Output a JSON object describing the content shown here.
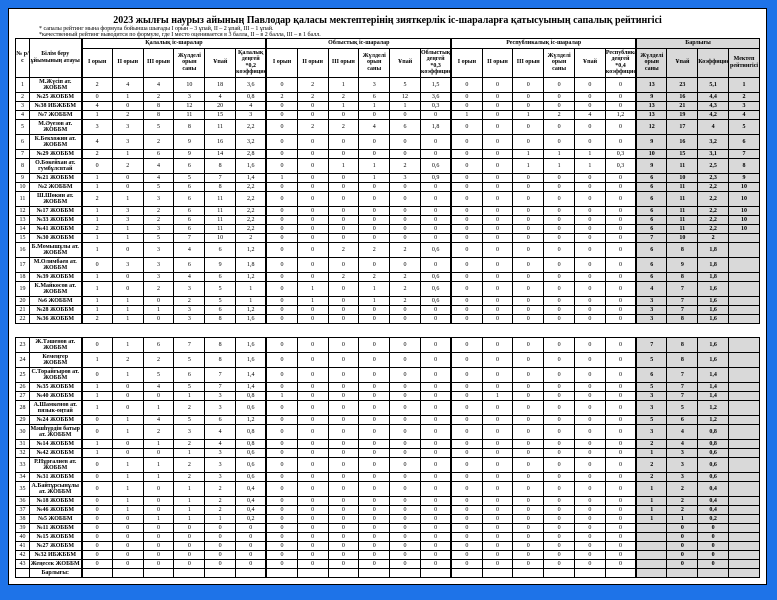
{
  "title": "2023 жылғы наурыз айының Павлодар қаласы мектептерінің зияткерлік іс-шараларға қатысуының сапалық рейтингісі",
  "note1": "* сапалы рейтинг мына формула бойынша шығады І орын – 3 ұпай, ІІ – 2 ұпай, ІІІ – 1 ұпай.",
  "note2": "*качественный рейтинг выводится по формуле, где І место оценивается в 3 балла, ІІ – в 2 балла, ІІІ – в 1 балл.",
  "grp": [
    "Қалалық іс-шаралар",
    "Облыстық іс-шаралар",
    "Республикалық іс-шаралар",
    "Барлығы"
  ],
  "col0": "№ р/с",
  "col1": "Білім беру ұйымының атауы",
  "cols_city": [
    "І орын",
    "ІІ орын",
    "ІІІ орын",
    "Жүлделі орын саны",
    "Ұпай",
    "Қалалық деңгей *0,2 коэффициенті"
  ],
  "cols_obl": [
    "І орын",
    "ІІ орын",
    "ІІІ орын",
    "Жүлделі орын саны",
    "Ұпай",
    "Облыстық деңгей *0,3 коэффициенті"
  ],
  "cols_rep": [
    "І орын",
    "ІІ орын",
    "ІІІ орын",
    "Жүлделі орын саны",
    "Ұпай",
    "Республикалық деңгей *0,4 коэффициенті"
  ],
  "cols_tot": [
    "Жүлделі орын саны",
    "Ұпай",
    "Коэффициенті",
    "Мектеп рейтингісі"
  ],
  "rows1": [
    {
      "n": 1,
      "name": "М.Жүсіп ат. ЖОББМ",
      "c": [
        2,
        4,
        4,
        10,
        18,
        "3,6"
      ],
      "o": [
        0,
        2,
        1,
        3,
        5,
        "1,5"
      ],
      "r": [
        0,
        0,
        0,
        0,
        0,
        0
      ],
      "t": [
        13,
        23,
        "5,1",
        1
      ]
    },
    {
      "n": 2,
      "name": "№25 ЖОББМ",
      "c": [
        0,
        1,
        2,
        3,
        4,
        "0,8"
      ],
      "o": [
        2,
        2,
        2,
        6,
        12,
        "3,6"
      ],
      "r": [
        0,
        0,
        0,
        0,
        0,
        0
      ],
      "t": [
        9,
        16,
        "4,4",
        2
      ]
    },
    {
      "n": 3,
      "name": "№38 ИБЖББМ",
      "c": [
        4,
        0,
        8,
        12,
        20,
        4
      ],
      "o": [
        0,
        0,
        1,
        1,
        1,
        "0,3"
      ],
      "r": [
        0,
        0,
        0,
        0,
        0,
        0
      ],
      "t": [
        13,
        21,
        "4,3",
        3
      ]
    },
    {
      "n": 4,
      "name": "№7 ЖОББМ",
      "c": [
        1,
        2,
        8,
        11,
        15,
        3
      ],
      "o": [
        0,
        0,
        0,
        0,
        0,
        0
      ],
      "r": [
        1,
        0,
        1,
        2,
        4,
        "1,2"
      ],
      "t": [
        13,
        19,
        "4,2",
        4
      ]
    },
    {
      "n": 5,
      "name": "М.Әуезов ат. ЖОББМ",
      "c": [
        3,
        3,
        5,
        8,
        11,
        "2,2"
      ],
      "o": [
        0,
        2,
        2,
        4,
        6,
        "1,8"
      ],
      "r": [
        0,
        0,
        0,
        0,
        0,
        0
      ],
      "t": [
        12,
        17,
        4,
        5
      ]
    },
    {
      "n": 6,
      "name": "К.Бекхожин ат. ЖОББМ",
      "c": [
        4,
        3,
        2,
        9,
        16,
        "3,2"
      ],
      "o": [
        0,
        0,
        0,
        0,
        0,
        0
      ],
      "r": [
        0,
        0,
        0,
        0,
        0,
        0
      ],
      "t": [
        9,
        16,
        "3,2",
        6
      ]
    },
    {
      "n": 7,
      "name": "№29 ЖОББМ",
      "c": [
        2,
        1,
        6,
        9,
        14,
        "2,8"
      ],
      "o": [
        0,
        0,
        0,
        0,
        0,
        0
      ],
      "r": [
        0,
        0,
        1,
        1,
        1,
        "0,3"
      ],
      "t": [
        10,
        15,
        "3,1",
        7
      ]
    },
    {
      "n": 8,
      "name": "О.Бокейхан ат. гумбұлсвтай",
      "c": [
        0,
        2,
        4,
        6,
        8,
        "1,6"
      ],
      "o": [
        0,
        0,
        1,
        1,
        2,
        "0,6"
      ],
      "r": [
        0,
        0,
        1,
        1,
        1,
        "0,3"
      ],
      "t": [
        9,
        11,
        "2,5",
        8
      ]
    },
    {
      "n": 9,
      "name": "№21 ЖОББМ",
      "c": [
        1,
        0,
        4,
        5,
        7,
        "1,4"
      ],
      "o": [
        1,
        0,
        0,
        1,
        3,
        "0,9"
      ],
      "r": [
        0,
        0,
        0,
        0,
        0,
        0
      ],
      "t": [
        6,
        10,
        "2,3",
        9
      ]
    },
    {
      "n": 10,
      "name": "№2 ЖОББМ",
      "c": [
        1,
        0,
        5,
        6,
        8,
        "2,2"
      ],
      "o": [
        0,
        0,
        0,
        0,
        0,
        0
      ],
      "r": [
        0,
        0,
        0,
        0,
        0,
        0
      ],
      "t": [
        6,
        11,
        "2,2",
        10
      ]
    },
    {
      "n": 11,
      "name": "Ш.Шөкин ат. ЖОББМ",
      "c": [
        2,
        1,
        3,
        6,
        11,
        "2,2"
      ],
      "o": [
        0,
        0,
        0,
        0,
        0,
        0
      ],
      "r": [
        0,
        0,
        0,
        0,
        0,
        0
      ],
      "t": [
        6,
        11,
        "2,2",
        10
      ]
    },
    {
      "n": 12,
      "name": "№17 ЖОББМ",
      "c": [
        1,
        3,
        2,
        6,
        11,
        "2,2"
      ],
      "o": [
        0,
        0,
        0,
        0,
        0,
        0
      ],
      "r": [
        0,
        0,
        0,
        0,
        0,
        0
      ],
      "t": [
        6,
        11,
        "2,2",
        10
      ]
    },
    {
      "n": 13,
      "name": "№33 ЖОББМ",
      "c": [
        1,
        3,
        2,
        6,
        11,
        "2,2"
      ],
      "o": [
        0,
        0,
        0,
        0,
        0,
        0
      ],
      "r": [
        0,
        0,
        0,
        0,
        0,
        0
      ],
      "t": [
        6,
        11,
        "2,2",
        10
      ]
    },
    {
      "n": 14,
      "name": "№41 ЖОББМ",
      "c": [
        2,
        1,
        3,
        6,
        11,
        "2,2"
      ],
      "o": [
        0,
        0,
        0,
        0,
        0,
        0
      ],
      "r": [
        0,
        0,
        0,
        0,
        0,
        0
      ],
      "t": [
        6,
        11,
        "2,2",
        10
      ]
    },
    {
      "n": 15,
      "name": "№30 ЖОББМ",
      "c": [
        1,
        1,
        5,
        7,
        10,
        2
      ],
      "o": [
        0,
        0,
        0,
        0,
        0,
        0
      ],
      "r": [
        0,
        0,
        0,
        0,
        0,
        0
      ],
      "t": [
        7,
        10,
        2,
        ""
      ]
    },
    {
      "n": 16,
      "name": "Б.Момышұлы ат. ЖОББМ",
      "c": [
        1,
        0,
        3,
        4,
        6,
        "1,2"
      ],
      "o": [
        0,
        0,
        2,
        2,
        2,
        "0,6"
      ],
      "r": [
        0,
        0,
        0,
        0,
        0,
        0
      ],
      "t": [
        6,
        8,
        "1,8",
        ""
      ]
    },
    {
      "n": 17,
      "name": "М.Олимбаев ат. ЖОББМ",
      "c": [
        0,
        3,
        3,
        6,
        9,
        "1,8"
      ],
      "o": [
        0,
        0,
        0,
        0,
        0,
        0
      ],
      "r": [
        0,
        0,
        0,
        0,
        0,
        0
      ],
      "t": [
        6,
        9,
        "1,8",
        ""
      ]
    },
    {
      "n": 18,
      "name": "№39 ЖОББМ",
      "c": [
        1,
        0,
        3,
        4,
        6,
        "1,2"
      ],
      "o": [
        0,
        0,
        2,
        2,
        2,
        "0,6"
      ],
      "r": [
        0,
        0,
        0,
        0,
        0,
        0
      ],
      "t": [
        6,
        8,
        "1,8",
        ""
      ]
    },
    {
      "n": 19,
      "name": "К.Майкөсов ат. ЖОББМ",
      "c": [
        1,
        0,
        2,
        3,
        5,
        1
      ],
      "o": [
        0,
        1,
        0,
        1,
        2,
        "0,6"
      ],
      "r": [
        0,
        0,
        0,
        0,
        0,
        0
      ],
      "t": [
        4,
        7,
        "1,6",
        ""
      ]
    },
    {
      "n": 20,
      "name": "№6 ЖОББМ",
      "c": [
        1,
        1,
        0,
        2,
        5,
        1
      ],
      "o": [
        0,
        1,
        0,
        1,
        2,
        "0,6"
      ],
      "r": [
        0,
        0,
        0,
        0,
        0,
        0
      ],
      "t": [
        3,
        7,
        "1,6",
        ""
      ]
    },
    {
      "n": 21,
      "name": "№28 ЖОББМ",
      "c": [
        1,
        1,
        1,
        3,
        6,
        "1,2"
      ],
      "o": [
        0,
        0,
        0,
        0,
        0,
        0
      ],
      "r": [
        0,
        0,
        0,
        0,
        0,
        0
      ],
      "t": [
        3,
        7,
        "1,6",
        ""
      ]
    },
    {
      "n": 22,
      "name": "№36 ЖОББМ",
      "c": [
        2,
        1,
        0,
        3,
        8,
        "1,6"
      ],
      "o": [
        0,
        0,
        0,
        0,
        0,
        0
      ],
      "r": [
        0,
        0,
        0,
        0,
        0,
        0
      ],
      "t": [
        3,
        8,
        "1,6",
        ""
      ]
    }
  ],
  "rows2": [
    {
      "n": 23,
      "name": "Ж.Тәшенов ат. ЖОББМ",
      "c": [
        0,
        1,
        6,
        7,
        8,
        "1,6"
      ],
      "o": [
        0,
        0,
        0,
        0,
        0,
        0
      ],
      "r": [
        0,
        0,
        0,
        0,
        0,
        0
      ],
      "t": [
        7,
        8,
        "1,6",
        ""
      ]
    },
    {
      "n": 24,
      "name": "Кемеңгер ЖОББМ",
      "c": [
        1,
        2,
        2,
        5,
        8,
        "1,6"
      ],
      "o": [
        0,
        0,
        0,
        0,
        0,
        0
      ],
      "r": [
        0,
        0,
        0,
        0,
        0,
        0
      ],
      "t": [
        5,
        8,
        "1,6",
        ""
      ]
    },
    {
      "n": 25,
      "name": "С.Торайғыров ат. ЖОББМ",
      "c": [
        0,
        1,
        5,
        6,
        7,
        "1,4"
      ],
      "o": [
        0,
        0,
        0,
        0,
        0,
        0
      ],
      "r": [
        0,
        0,
        0,
        0,
        0,
        0
      ],
      "t": [
        6,
        7,
        "1,4",
        ""
      ]
    },
    {
      "n": 26,
      "name": "№35 ЖОББМ",
      "c": [
        1,
        0,
        4,
        5,
        7,
        "1,4"
      ],
      "o": [
        0,
        0,
        0,
        0,
        0,
        0
      ],
      "r": [
        0,
        0,
        0,
        0,
        0,
        0
      ],
      "t": [
        5,
        7,
        "1,4",
        ""
      ]
    },
    {
      "n": 27,
      "name": "№40 ЖОББМ",
      "c": [
        1,
        0,
        0,
        1,
        3,
        "0,8"
      ],
      "o": [
        1,
        0,
        0,
        0,
        0,
        0
      ],
      "r": [
        0,
        1,
        0,
        0,
        0,
        0
      ],
      "t": [
        3,
        7,
        "1,4",
        ""
      ]
    },
    {
      "n": 28,
      "name": "А.Шамкенов ат. пязык-оңтай",
      "c": [
        1,
        0,
        1,
        2,
        3,
        "0,6"
      ],
      "o": [
        0,
        0,
        0,
        0,
        0,
        0
      ],
      "r": [
        0,
        0,
        0,
        0,
        0,
        0
      ],
      "t": [
        3,
        5,
        "1,2",
        ""
      ]
    },
    {
      "n": 29,
      "name": "№24 ЖОББМ",
      "c": [
        0,
        1,
        4,
        5,
        6,
        "1,2"
      ],
      "o": [
        0,
        0,
        0,
        0,
        0,
        0
      ],
      "r": [
        0,
        0,
        0,
        0,
        0,
        0
      ],
      "t": [
        5,
        6,
        "1,2",
        ""
      ]
    },
    {
      "n": 30,
      "name": "Мәшһүрдін батыр ат. ЖОББМ",
      "c": [
        0,
        1,
        2,
        3,
        4,
        "0,8"
      ],
      "o": [
        0,
        0,
        0,
        0,
        0,
        0
      ],
      "r": [
        0,
        0,
        0,
        0,
        0,
        0
      ],
      "t": [
        3,
        4,
        "0,8",
        ""
      ]
    },
    {
      "n": 31,
      "name": "№14 ЖОББМ",
      "c": [
        1,
        0,
        1,
        2,
        4,
        "0,8"
      ],
      "o": [
        0,
        0,
        0,
        0,
        0,
        0
      ],
      "r": [
        0,
        0,
        0,
        0,
        0,
        0
      ],
      "t": [
        2,
        4,
        "0,8",
        ""
      ]
    },
    {
      "n": 32,
      "name": "№42 ЖОББМ",
      "c": [
        1,
        0,
        0,
        1,
        3,
        "0,6"
      ],
      "o": [
        0,
        0,
        0,
        0,
        0,
        0
      ],
      "r": [
        0,
        0,
        0,
        0,
        0,
        0
      ],
      "t": [
        1,
        3,
        "0,6",
        ""
      ]
    },
    {
      "n": 33,
      "name": "Р.Нұрғалиев ат. ЖОББМ",
      "c": [
        0,
        1,
        1,
        2,
        3,
        "0,6"
      ],
      "o": [
        0,
        0,
        0,
        0,
        0,
        0
      ],
      "r": [
        0,
        0,
        0,
        0,
        0,
        0
      ],
      "t": [
        2,
        3,
        "0,6",
        ""
      ]
    },
    {
      "n": 34,
      "name": "№31 ЖОББМ",
      "c": [
        0,
        1,
        1,
        2,
        3,
        "0,6"
      ],
      "o": [
        0,
        0,
        0,
        0,
        0,
        0
      ],
      "r": [
        0,
        0,
        0,
        0,
        0,
        0
      ],
      "t": [
        2,
        3,
        "0,6",
        ""
      ]
    },
    {
      "n": 35,
      "name": "А.Байтұрсынұлы ат. ЖОББМ",
      "c": [
        0,
        1,
        0,
        1,
        2,
        "0,4"
      ],
      "o": [
        0,
        0,
        0,
        0,
        0,
        0
      ],
      "r": [
        0,
        0,
        0,
        0,
        0,
        0
      ],
      "t": [
        1,
        2,
        "0,4",
        ""
      ]
    },
    {
      "n": 36,
      "name": "№18 ЖОББМ",
      "c": [
        0,
        1,
        0,
        1,
        2,
        "0,4"
      ],
      "o": [
        0,
        0,
        0,
        0,
        0,
        0
      ],
      "r": [
        0,
        0,
        0,
        0,
        0,
        0
      ],
      "t": [
        1,
        2,
        "0,4",
        ""
      ]
    },
    {
      "n": 37,
      "name": "№46 ЖОББМ",
      "c": [
        0,
        1,
        0,
        1,
        2,
        "0,4"
      ],
      "o": [
        0,
        0,
        0,
        0,
        0,
        0
      ],
      "r": [
        0,
        0,
        0,
        0,
        0,
        0
      ],
      "t": [
        1,
        2,
        "0,4",
        ""
      ]
    },
    {
      "n": 38,
      "name": "№5 ЖОББМ",
      "c": [
        0,
        0,
        1,
        1,
        1,
        "0,2"
      ],
      "o": [
        0,
        0,
        0,
        0,
        0,
        0
      ],
      "r": [
        0,
        0,
        0,
        0,
        0,
        0
      ],
      "t": [
        1,
        1,
        "0,2",
        ""
      ]
    },
    {
      "n": 39,
      "name": "№11 ЖОББМ",
      "c": [
        0,
        0,
        0,
        0,
        0,
        0
      ],
      "o": [
        0,
        0,
        0,
        0,
        0,
        0
      ],
      "r": [
        0,
        0,
        0,
        0,
        0,
        0
      ],
      "t": [
        "",
        0,
        0,
        ""
      ]
    },
    {
      "n": 40,
      "name": "№15 ЖОББМ",
      "c": [
        0,
        0,
        0,
        0,
        0,
        0
      ],
      "o": [
        0,
        0,
        0,
        0,
        0,
        0
      ],
      "r": [
        0,
        0,
        0,
        0,
        0,
        0
      ],
      "t": [
        "",
        0,
        0,
        ""
      ]
    },
    {
      "n": 41,
      "name": "№27 ЖОББМ",
      "c": [
        0,
        0,
        0,
        0,
        0,
        0
      ],
      "o": [
        0,
        0,
        0,
        0,
        0,
        0
      ],
      "r": [
        0,
        0,
        0,
        0,
        0,
        0
      ],
      "t": [
        "",
        0,
        0,
        ""
      ]
    },
    {
      "n": 42,
      "name": "№32 ИБЖББМ",
      "c": [
        0,
        0,
        0,
        0,
        0,
        0
      ],
      "o": [
        0,
        0,
        0,
        0,
        0,
        0
      ],
      "r": [
        0,
        0,
        0,
        0,
        0,
        0
      ],
      "t": [
        "",
        0,
        0,
        ""
      ]
    },
    {
      "n": 43,
      "name": "Жеңесек ЖОББМ",
      "c": [
        0,
        0,
        0,
        0,
        0,
        0
      ],
      "o": [
        0,
        0,
        0,
        0,
        0,
        0
      ],
      "r": [
        0,
        0,
        0,
        0,
        0,
        0
      ],
      "t": [
        "",
        0,
        0,
        ""
      ]
    }
  ],
  "footer_label": "Барлығы:",
  "footer": [
    "",
    "",
    "",
    "",
    "",
    "",
    "",
    "",
    "",
    "",
    "",
    "",
    "",
    "",
    "",
    "",
    "",
    "",
    "",
    "",
    "",
    ""
  ]
}
